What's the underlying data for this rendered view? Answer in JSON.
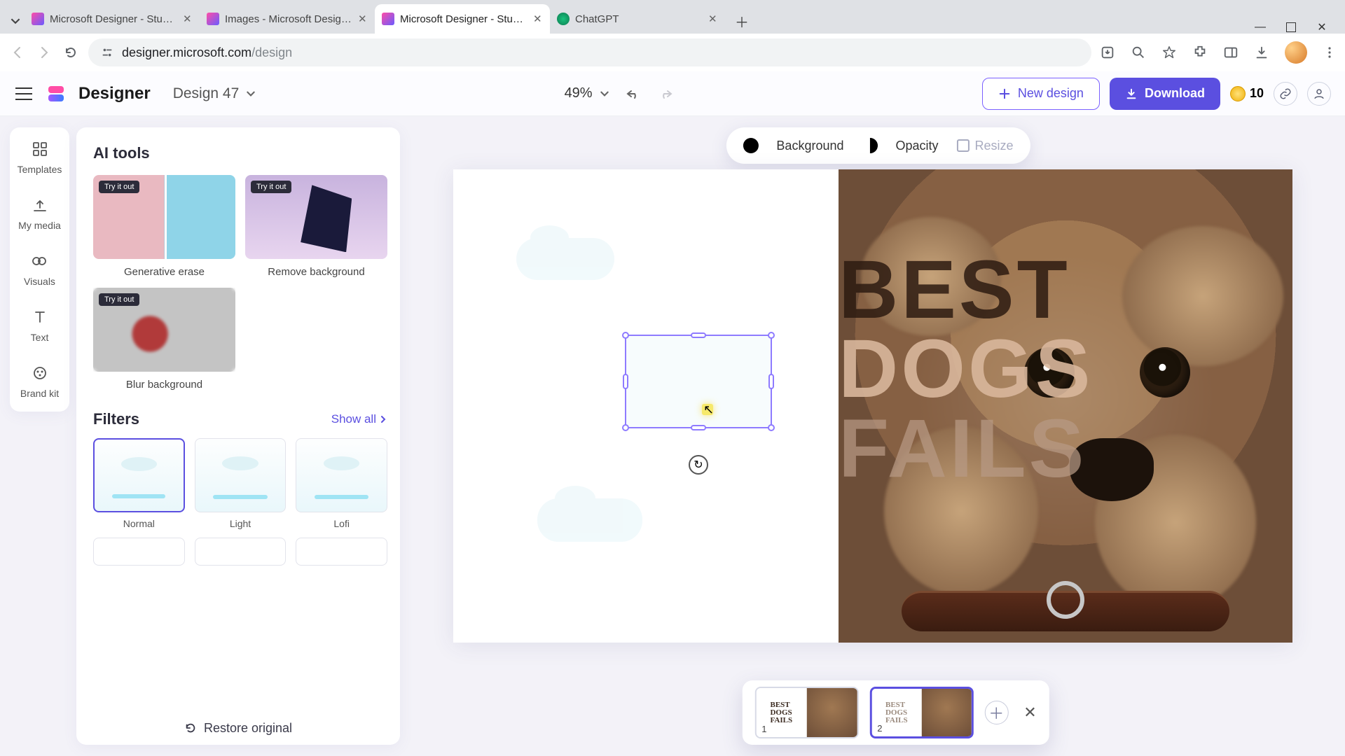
{
  "browser": {
    "tabs": [
      {
        "title": "Microsoft Designer - Stunning"
      },
      {
        "title": "Images - Microsoft Designer"
      },
      {
        "title": "Microsoft Designer - Stunning"
      },
      {
        "title": "ChatGPT"
      }
    ],
    "url_host": "designer.microsoft.com",
    "url_path": "/design"
  },
  "header": {
    "brand": "Designer",
    "design_title": "Design 47",
    "zoom": "49%",
    "new_design": "New design",
    "download": "Download",
    "coins": "10"
  },
  "rail": {
    "templates": "Templates",
    "mymedia": "My media",
    "visuals": "Visuals",
    "text": "Text",
    "brandkit": "Brand kit"
  },
  "panel": {
    "ai_tools_title": "AI tools",
    "try_badge": "Try it out",
    "gen_erase": "Generative erase",
    "remove_bg": "Remove background",
    "blur_bg": "Blur background",
    "filters_title": "Filters",
    "show_all": "Show all",
    "filters": {
      "normal": "Normal",
      "light": "Light",
      "lofi": "Lofi"
    },
    "restore": "Restore original"
  },
  "context_bar": {
    "background": "Background",
    "opacity": "Opacity",
    "resize": "Resize"
  },
  "artboard": {
    "text_lines": {
      "l1": "BEST",
      "l2": "DOGS",
      "l3": "FAILS"
    }
  },
  "tray": {
    "thumb1_index": "1",
    "thumb2_index": "2",
    "thumb_text": "BEST\nDOGS\nFAILS"
  }
}
